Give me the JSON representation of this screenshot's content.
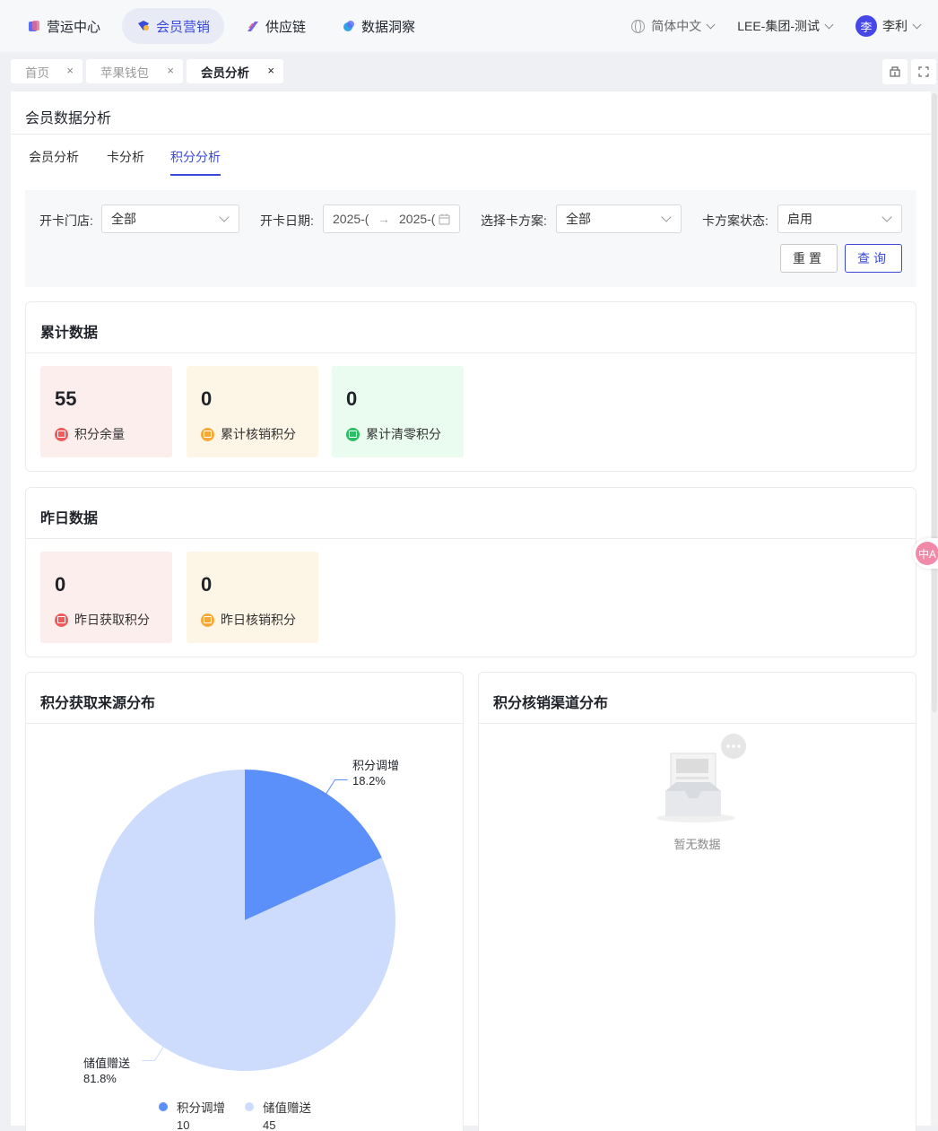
{
  "topnav": {
    "items": [
      {
        "label": "营运中心",
        "icon": "operations-icon",
        "color": "#5b6cf7"
      },
      {
        "label": "会员营销",
        "icon": "member-marketing-icon",
        "color": "#3b4bd8"
      },
      {
        "label": "供应链",
        "icon": "supply-chain-icon",
        "color": "#7a63e8"
      },
      {
        "label": "数据洞察",
        "icon": "data-insight-icon",
        "color": "#33a3e8"
      }
    ],
    "language": "简体中文",
    "org": "LEE-集团-测试",
    "user_initial": "李",
    "user_name": "李利"
  },
  "tabs": [
    {
      "label": "首页",
      "close": "×"
    },
    {
      "label": "苹果钱包",
      "close": "×"
    },
    {
      "label": "会员分析",
      "close": "×"
    }
  ],
  "page": {
    "title": "会员数据分析",
    "subtabs": [
      "会员分析",
      "卡分析",
      "积分分析"
    ]
  },
  "filters": {
    "store_label": "开卡门店:",
    "store_value": "全部",
    "date_label": "开卡日期:",
    "date_start": "2025-(",
    "date_sep": "→",
    "date_end": "2025-(",
    "plan_label": "选择卡方案:",
    "plan_value": "全部",
    "status_label": "卡方案状态:",
    "status_value": "启用",
    "reset_label": "重置",
    "query_label": "查询"
  },
  "cumulative": {
    "title": "累计数据",
    "stats": [
      {
        "value": "55",
        "label": "积分余量",
        "icon": "wallet-icon",
        "color": "#f05a5a"
      },
      {
        "value": "0",
        "label": "累计核销积分",
        "icon": "coin-icon",
        "color": "#f5a93a"
      },
      {
        "value": "0",
        "label": "累计清零积分",
        "icon": "cash-icon",
        "color": "#2dbd63"
      }
    ]
  },
  "yesterday": {
    "title": "昨日数据",
    "stats": [
      {
        "value": "0",
        "label": "昨日获取积分",
        "icon": "wallet-icon",
        "color": "#f05a5a"
      },
      {
        "value": "0",
        "label": "昨日核销积分",
        "icon": "coin-icon",
        "color": "#f5a93a"
      }
    ]
  },
  "source_chart": {
    "title": "积分获取来源分布",
    "slice_labels": [
      {
        "name": "积分调增",
        "pct": "18.2%"
      },
      {
        "name": "储值赠送",
        "pct": "81.8%"
      }
    ],
    "legend": [
      {
        "name": "积分调增",
        "value": "10"
      },
      {
        "name": "储值赠送",
        "value": "45"
      }
    ]
  },
  "channel_chart": {
    "title": "积分核销渠道分布",
    "empty_text": "暂无数据"
  },
  "chart_data": {
    "type": "pie",
    "categories": [
      "积分调增",
      "储值赠送"
    ],
    "values": [
      10,
      45
    ],
    "percentages": [
      18.2,
      81.8
    ],
    "colors": [
      "#5b8ff9",
      "#cddcfd"
    ],
    "title": "积分获取来源分布",
    "legend_position": "bottom"
  },
  "float_button": {
    "label": "中A"
  }
}
